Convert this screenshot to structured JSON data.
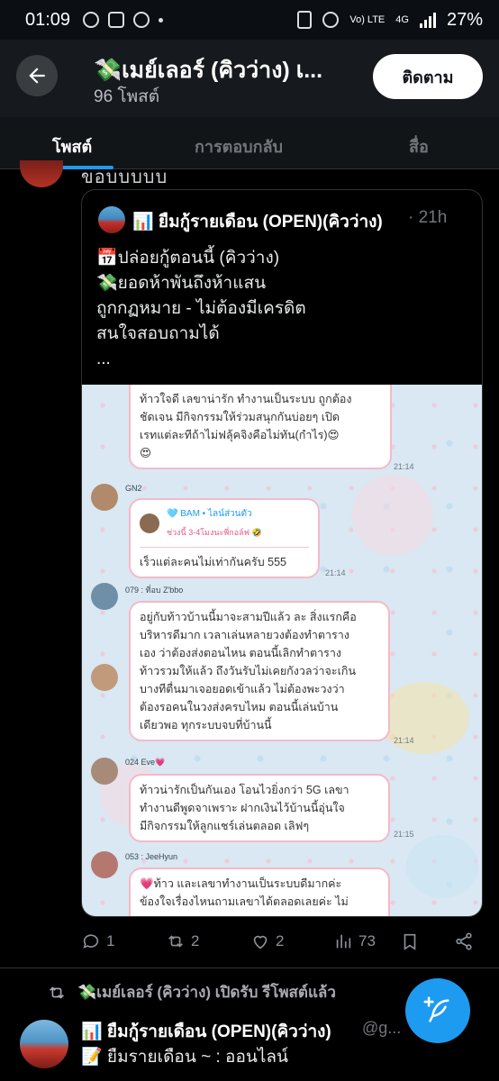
{
  "status_bar": {
    "time": "01:09",
    "battery": "27%",
    "network": "4G",
    "volte": "Vo) LTE"
  },
  "header": {
    "title": "💸เมย์เลอร์ (คิวว่าง) เ...",
    "post_count": "96 โพสต์",
    "follow_label": "ติดตาม"
  },
  "tabs": [
    "โพสต์",
    "การตอบกลับ",
    "สื่อ"
  ],
  "feed": {
    "partial_text": "ขอบบบบบ",
    "quoted": {
      "name": "📊 ยืมกู้รายเดือน (OPEN)(คิวว่าง)",
      "time": "· 21h",
      "lines": [
        "📅ปล่อยกู้ตอนนี้ (คิวว่าง)",
        "💸ยอดห้าพันถึงห้าแสน",
        "ถูกกฏหมาย - ไม่ต้องมีเครดิต",
        "สนใจสอบถามได้",
        "..."
      ]
    },
    "chat": {
      "msg1": {
        "lines": [
          "ท้าวใจดี เลขาน่ารัก ทำงานเป็นระบบ ถูกต้อง",
          "ชัดเจน มีกิจกรรมให้ร่วมสนุกกันบ่อยๆ เปิด",
          "เรทแต่ละทีถ้าไม่ฟลุ้คจิงคือไม่ทัน(กำไร)😍",
          "😍"
        ],
        "time": "21:14"
      },
      "msg2": {
        "name": "GN2",
        "reply_name": "🩵 BAM • ไลน์ส่วนตัว",
        "reply_sub": "ช่วงนี้ 3-4โมงนะพี่กอล์ฟ 🤣",
        "text": "เร็วแต่ละคนไม่เท่ากันครับ 555",
        "time": "21:14"
      },
      "msg3": {
        "name": "079 : ที่อบ Z'bbo",
        "lines": [
          "อยู่กับท้าวบ้านนี้มาจะสามปีแล้ว ละ สิ่งแรกคือ",
          "บริหารดีมาก  เวลาเล่นหลายวงต้องทำตาราง",
          "เอง ว่าต้องส่งตอนไหน ตอนนี้เลิกทำตาราง",
          "ท้าวรวมให้แล้ว ถึงวันรับไม่เคยกังวลว่าจะเกิน",
          "บางทีตื่นมาเจอยอดเข้าแล้ว  ไม่ต้องพะวงว่า",
          "ต้องรอคนในวงส่งครบไหม ตอนนี้เล่นบ้าน",
          "เดียวพอ ทุกระบบจบที่บ้านนี้"
        ],
        "time": "21:14"
      },
      "msg4": {
        "name": "024 Eve💗",
        "lines": [
          "ท้าวน่ารักเป็นกันเอง โอนไวยิ่งกว่า 5G   เลขา",
          "ทำงานดีพูดจาเพราะ  ฝากเงินไว้บ้านนี้อุ่นใจ",
          "มีกิจกรรมให้ลูกแชร์เล่นตลอด  เลิฟๆ"
        ],
        "time": "21:15"
      },
      "msg5": {
        "name": "053 : JeeHyun",
        "lines": [
          "💗ท้าว และเลขาทำงานเป็นระบบดีมากค่ะ",
          "ข้องใจเรื่องไหนถามเลขาได้ตลอดเลยค่ะ ไม่"
        ]
      }
    },
    "actions": {
      "replies": "1",
      "reposts": "2",
      "likes": "2",
      "views": "73"
    }
  },
  "next_tweet": {
    "repost_label": "💸เมย์เลอร์ (คิวว่าง) เปิดรับ รีโพสต์แล้ว",
    "name": "📊 ยืมกู้รายเดือน (OPEN)(คิวว่าง)",
    "handle": "@g...",
    "text": "📝 ยืมรายเดือน ~ : ออนไลน์"
  },
  "colors": {
    "accent": "#1d9bf0",
    "bubble_border": "#f5b9c8"
  }
}
